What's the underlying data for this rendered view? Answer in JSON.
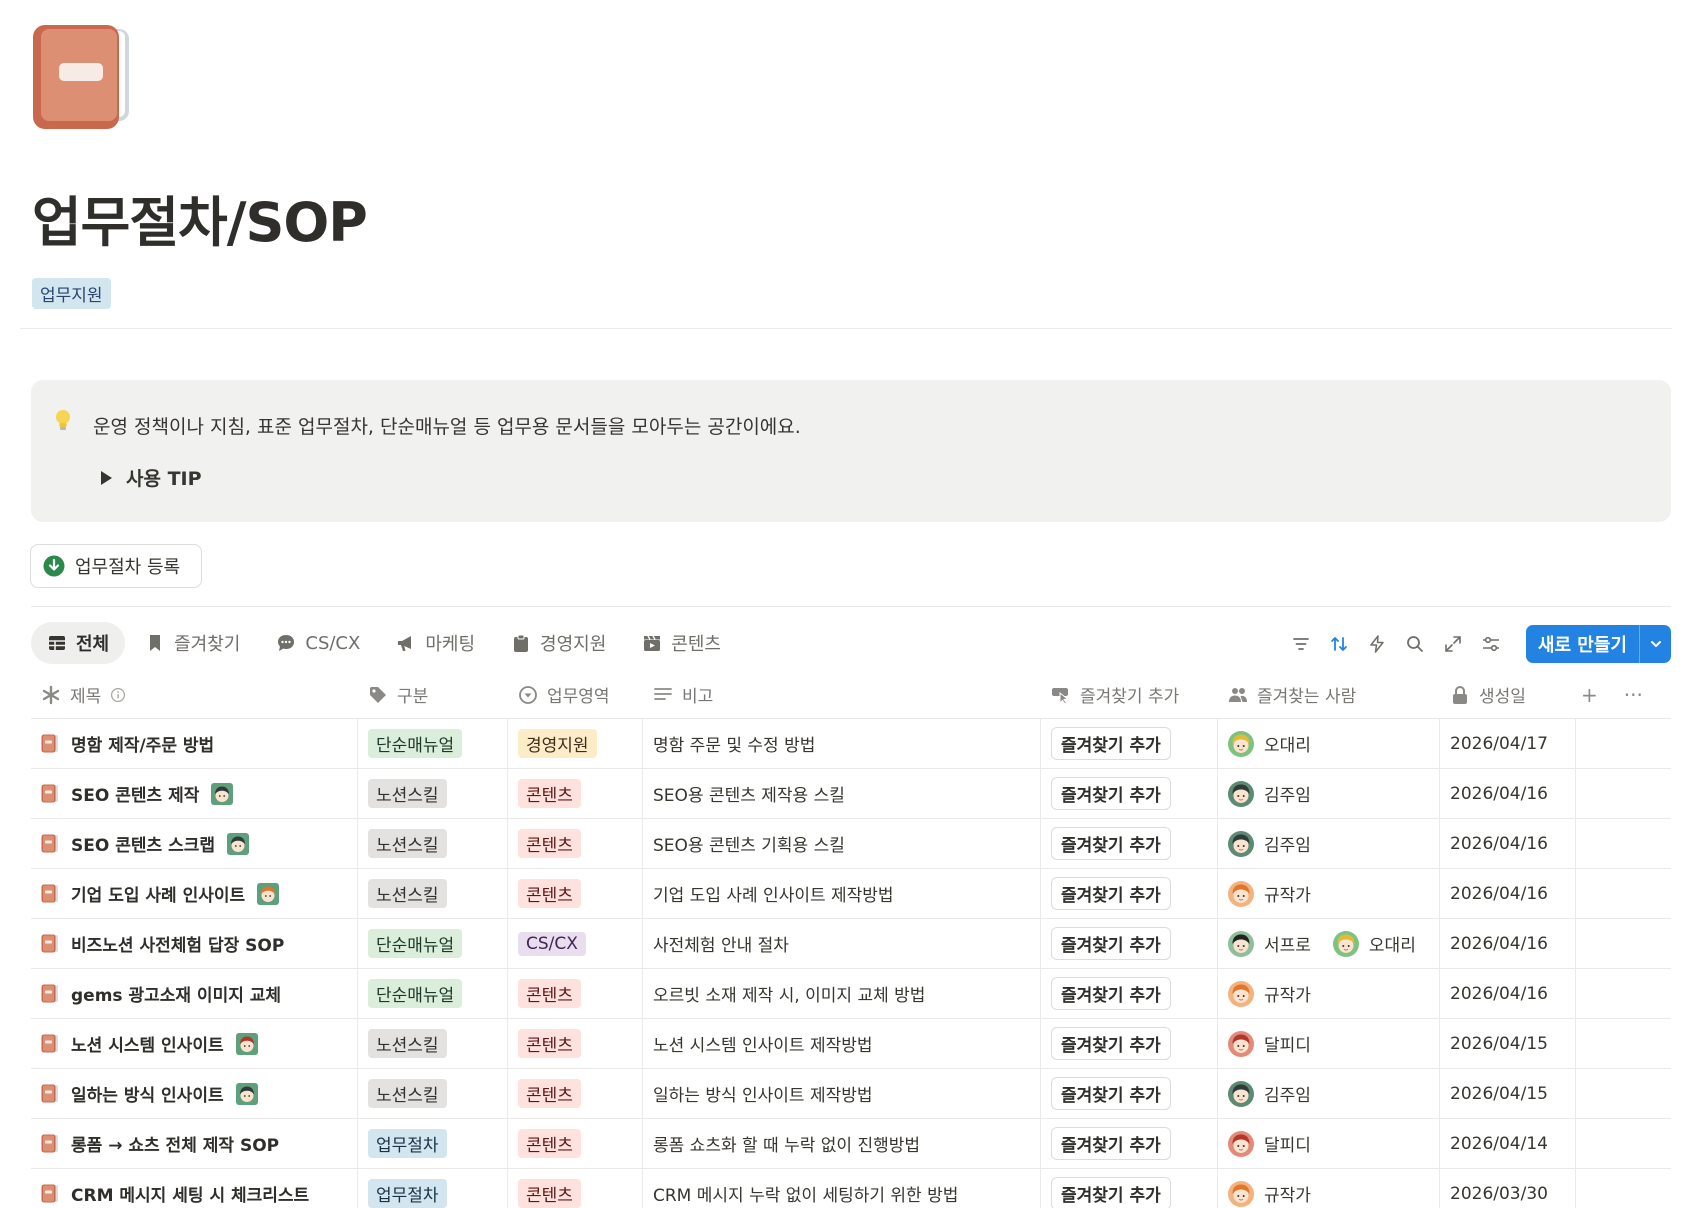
{
  "page": {
    "title": "업무절차/SOP",
    "tag": "업무지원"
  },
  "callout": {
    "text": "운영 정책이나 지침, 표준 업무절차, 단순매뉴얼 등 업무용 문서들을 모아두는 공간이에요.",
    "toggle_label": "사용 TIP"
  },
  "register_button": {
    "label": "업무절차 등록"
  },
  "tabs": [
    {
      "label": "전체",
      "icon": "table-icon"
    },
    {
      "label": "즐겨찾기",
      "icon": "bookmark-icon"
    },
    {
      "label": "CS/CX",
      "icon": "chat-bubble-icon"
    },
    {
      "label": "마케팅",
      "icon": "megaphone-icon"
    },
    {
      "label": "경영지원",
      "icon": "clipboard-icon"
    },
    {
      "label": "콘텐츠",
      "icon": "clapperboard-icon"
    }
  ],
  "toolbar": {
    "new_button": "새로 만들기",
    "icons": [
      "filter-icon",
      "sort-icon",
      "automation-icon",
      "search-icon",
      "expand-icon",
      "settings-icon"
    ]
  },
  "columns": [
    {
      "label": "제목",
      "icon": "asterisk-icon"
    },
    {
      "label": "구분",
      "icon": "tag-icon"
    },
    {
      "label": "업무영역",
      "icon": "status-icon"
    },
    {
      "label": "비고",
      "icon": "text-lines-icon"
    },
    {
      "label": "즐겨찾기 추가",
      "icon": "button-pointer-icon"
    },
    {
      "label": "즐겨찾는 사람",
      "icon": "people-icon"
    },
    {
      "label": "생성일",
      "icon": "lock-icon"
    }
  ],
  "header_actions": {
    "add": "+",
    "more": "···"
  },
  "fav_button_label": "즐겨찾기 추가",
  "colors": {
    "단순매뉴얼": {
      "bg": "#dbeddb",
      "fg": "#1c3829"
    },
    "노션스킬": {
      "bg": "#e3e2e0",
      "fg": "#32302c"
    },
    "업무절차": {
      "bg": "#d3e5ef",
      "fg": "#183347"
    },
    "경영지원": {
      "bg": "#fdecc8",
      "fg": "#402c1b"
    },
    "콘텐츠": {
      "bg": "#ffe2dd",
      "fg": "#5d1715"
    },
    "CS/CX": {
      "bg": "#e8deee",
      "fg": "#412454"
    },
    "accent": "#2383e2"
  },
  "rows": [
    {
      "title": "명함 제작/주문 방법",
      "title_avatar": "",
      "category": "단순매뉴얼",
      "area": "경영지원",
      "note": "명함 주문 및 수정 방법",
      "people": [
        {
          "name": "오대리",
          "avatar": "blonde"
        }
      ],
      "created": "2026/04/17"
    },
    {
      "title": "SEO 콘텐츠 제작",
      "title_avatar": "dark",
      "category": "노션스킬",
      "area": "콘텐츠",
      "note": "SEO용 콘텐츠 제작용 스킬",
      "people": [
        {
          "name": "김주임",
          "avatar": "dark"
        }
      ],
      "created": "2026/04/16"
    },
    {
      "title": "SEO 콘텐츠 스크랩",
      "title_avatar": "dark",
      "category": "노션스킬",
      "area": "콘텐츠",
      "note": "SEO용 콘텐츠 기획용 스킬",
      "people": [
        {
          "name": "김주임",
          "avatar": "dark"
        }
      ],
      "created": "2026/04/16"
    },
    {
      "title": "기업 도입 사례 인사이트",
      "title_avatar": "orange",
      "category": "노션스킬",
      "area": "콘텐츠",
      "note": "기업 도입 사례 인사이트 제작방법",
      "people": [
        {
          "name": "규작가",
          "avatar": "orange"
        }
      ],
      "created": "2026/04/16"
    },
    {
      "title": "비즈노션 사전체험 답장 SOP",
      "title_avatar": "",
      "category": "단순매뉴얼",
      "area": "CS/CX",
      "note": "사전체험 안내 절차",
      "people": [
        {
          "name": "서프로",
          "avatar": "black"
        },
        {
          "name": "오대리",
          "avatar": "blonde"
        }
      ],
      "created": "2026/04/16"
    },
    {
      "title": "gems 광고소재 이미지 교체",
      "title_avatar": "",
      "category": "단순매뉴얼",
      "area": "콘텐츠",
      "note": "오르빗 소재 제작 시, 이미지 교체 방법",
      "people": [
        {
          "name": "규작가",
          "avatar": "orange"
        }
      ],
      "created": "2026/04/16"
    },
    {
      "title": "노션 시스템 인사이트",
      "title_avatar": "red",
      "category": "노션스킬",
      "area": "콘텐츠",
      "note": "노션 시스템 인사이트 제작방법",
      "people": [
        {
          "name": "달피디",
          "avatar": "red"
        }
      ],
      "created": "2026/04/15"
    },
    {
      "title": "일하는 방식 인사이트",
      "title_avatar": "dark",
      "category": "노션스킬",
      "area": "콘텐츠",
      "note": "일하는 방식 인사이트 제작방법",
      "people": [
        {
          "name": "김주임",
          "avatar": "dark"
        }
      ],
      "created": "2026/04/15"
    },
    {
      "title": "롱폼 → 쇼츠 전체 제작 SOP",
      "title_avatar": "",
      "category": "업무절차",
      "area": "콘텐츠",
      "note": "롱폼 쇼츠화 할 때 누락 없이 진행방법",
      "people": [
        {
          "name": "달피디",
          "avatar": "red"
        }
      ],
      "created": "2026/04/14"
    },
    {
      "title": "CRM 메시지 세팅 시 체크리스트",
      "title_avatar": "",
      "category": "업무절차",
      "area": "콘텐츠",
      "note": "CRM 메시지 누락 없이 세팅하기 위한 방법",
      "people": [
        {
          "name": "규작가",
          "avatar": "orange"
        }
      ],
      "created": "2026/03/30"
    }
  ]
}
